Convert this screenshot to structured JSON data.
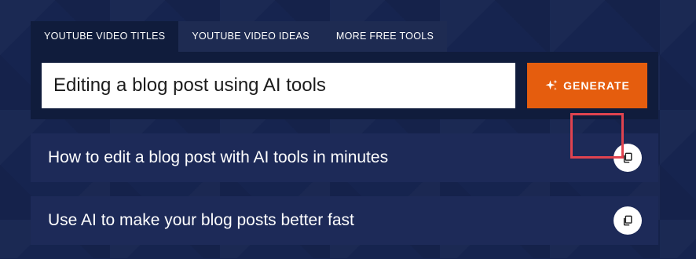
{
  "tabs": [
    {
      "label": "YOUTUBE VIDEO TITLES",
      "active": true
    },
    {
      "label": "YOUTUBE VIDEO IDEAS",
      "active": false
    },
    {
      "label": "MORE FREE TOOLS",
      "active": false
    }
  ],
  "search": {
    "value": "Editing a blog post using AI tools"
  },
  "generate": {
    "label": "GENERATE",
    "icon": "sparkle-icon"
  },
  "results": [
    {
      "text": "How to edit a blog post with AI tools in minutes",
      "copy_icon": "copy-icon"
    },
    {
      "text": "Use AI to make your blog posts better fast",
      "copy_icon": "copy-icon"
    }
  ],
  "colors": {
    "background": "#16244f",
    "panel": "#101c3c",
    "accent": "#e55d0e",
    "row": "#1d2a58",
    "highlight": "#e0434f"
  }
}
